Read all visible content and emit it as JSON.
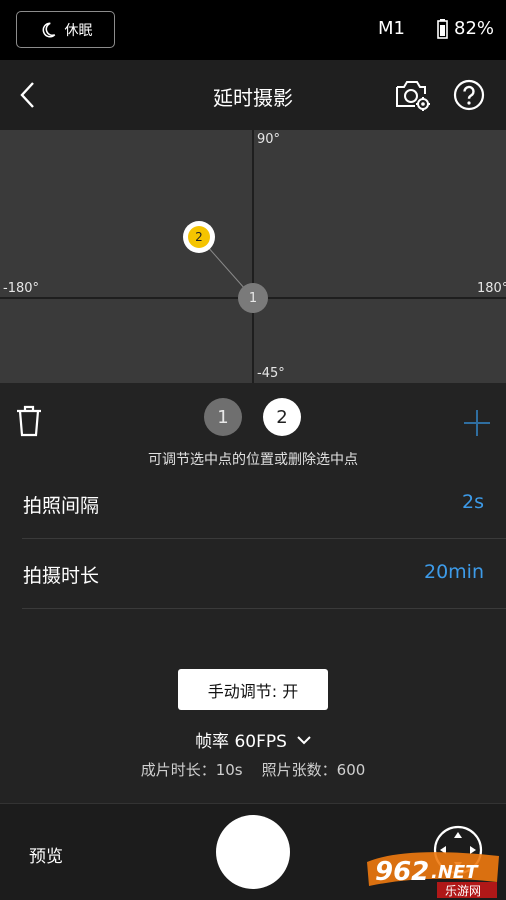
{
  "status_bar": {
    "sleep_label": "休眠",
    "mode": "M1",
    "battery": "82%"
  },
  "header": {
    "title": "延时摄影"
  },
  "graph": {
    "label_top": "90°",
    "label_left": "-180°",
    "label_right": "180°",
    "label_bottom": "-45°",
    "point_1_label": "1",
    "point_2_label": "2"
  },
  "points": {
    "tab_1": "1",
    "tab_2": "2",
    "hint": "可调节选中点的位置或删除选中点"
  },
  "settings": [
    {
      "label": "拍照间隔",
      "value": "2s"
    },
    {
      "label": "拍摄时长",
      "value": "20min"
    }
  ],
  "manual_button": "手动调节: 开",
  "frame_rate": "帧率 60FPS",
  "info": "成片时长：10s    照片张数：600",
  "bottom": {
    "preview_label": "预览"
  },
  "watermark": {
    "brand": "962.NET",
    "subtitle": "乐游网"
  },
  "colors": {
    "accent": "#3d9be9",
    "selected_point": "#f5c400"
  }
}
